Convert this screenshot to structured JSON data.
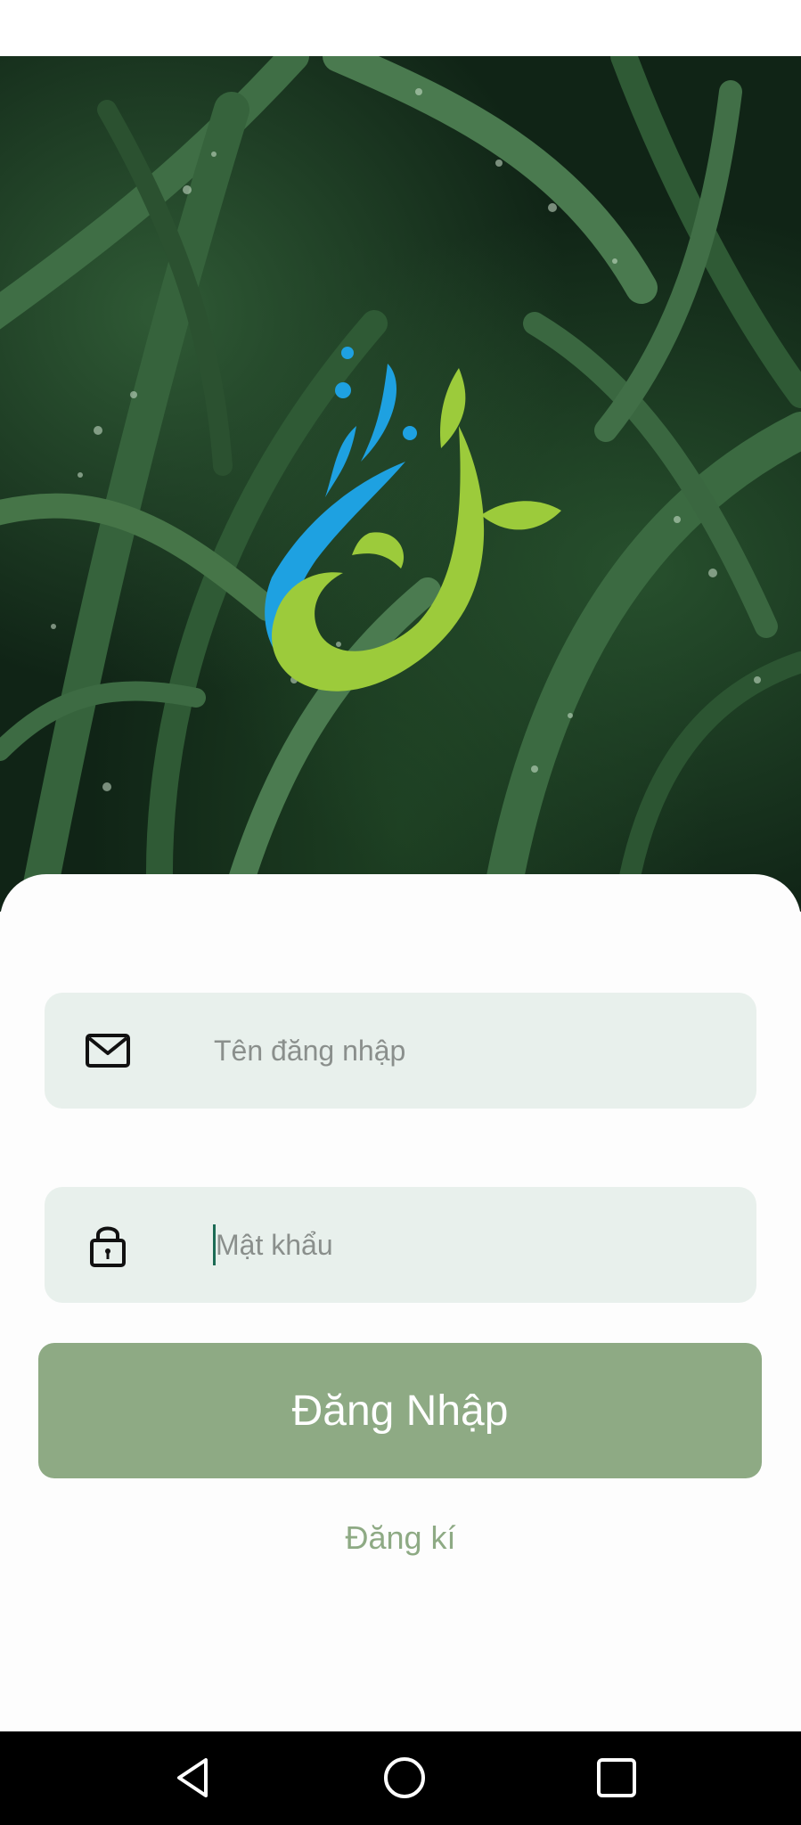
{
  "login_form": {
    "username_placeholder": "Tên đăng nhập",
    "username_value": "",
    "password_placeholder": "Mật khẩu",
    "password_value": "",
    "login_button_label": "Đăng Nhập",
    "register_link_label": "Đăng kí"
  },
  "icons": {
    "username": "mail-icon",
    "password": "lock-icon",
    "nav_back": "back-triangle-icon",
    "nav_home": "home-circle-icon",
    "nav_recents": "recents-square-icon"
  },
  "colors": {
    "primary_button": "#8eaa84",
    "field_background": "#e8f0ec",
    "register_link": "#8eaa84",
    "logo_blue": "#1ea1e1",
    "logo_green": "#9ccb3b"
  }
}
